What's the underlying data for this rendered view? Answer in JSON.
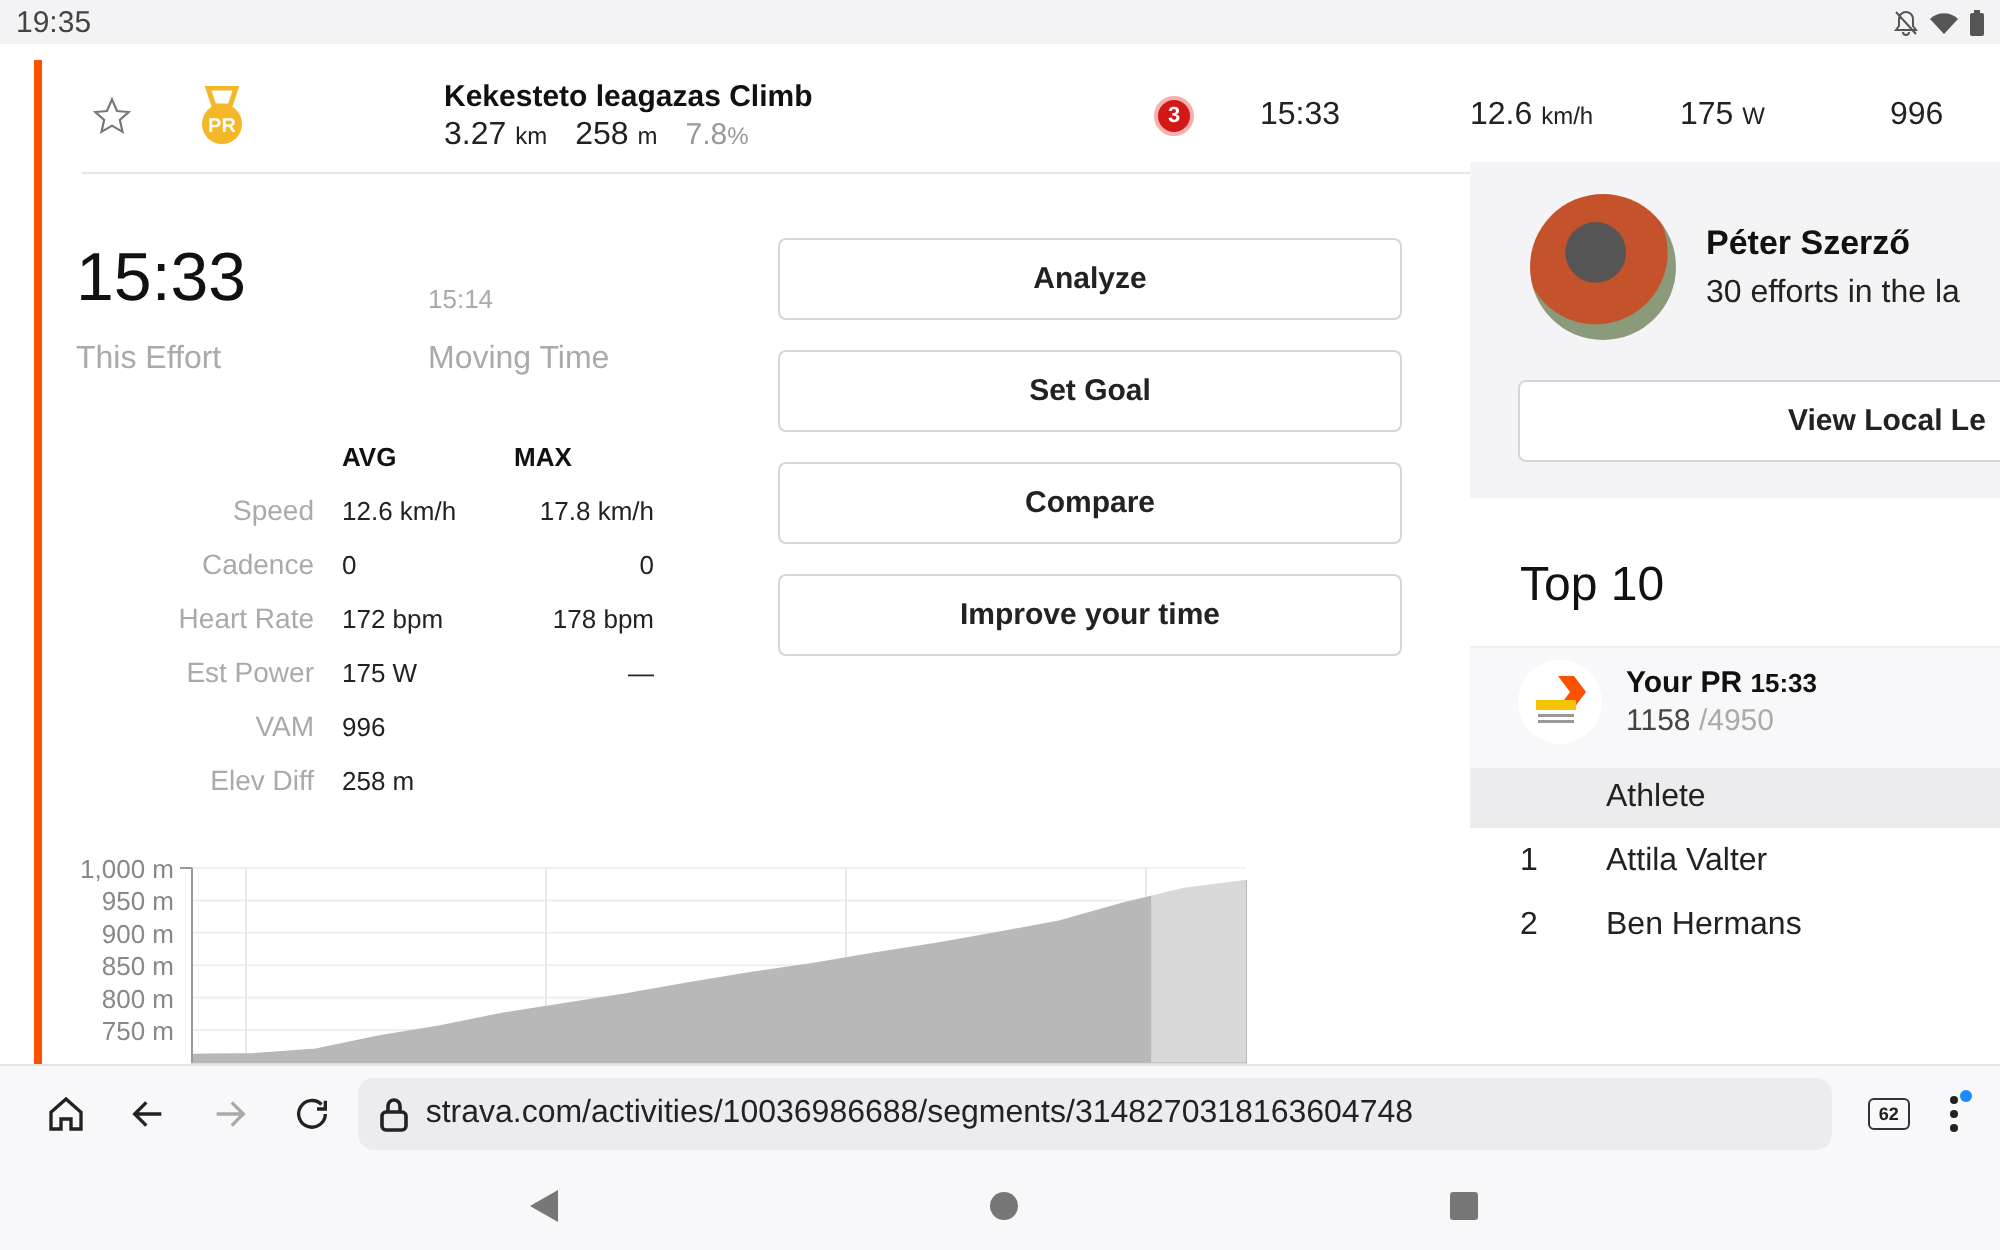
{
  "status_bar": {
    "time": "19:35"
  },
  "segment": {
    "starred": false,
    "pr_badge": "PR",
    "name": "Kekesteto leagazas Climb",
    "distance": {
      "value": "3.27",
      "unit": "km"
    },
    "elevation": {
      "value": "258",
      "unit": "m"
    },
    "grade": {
      "value": "7.8",
      "unit": "%"
    },
    "rank": "3",
    "time": "15:33",
    "speed": {
      "value": "12.6",
      "unit": "km/h"
    },
    "power": {
      "value": "175",
      "unit": "W"
    },
    "vam": "996"
  },
  "effort": {
    "time": "15:33",
    "time_label": "This Effort",
    "moving_time": "15:14",
    "moving_label": "Moving Time"
  },
  "stats": {
    "columns": [
      "AVG",
      "MAX"
    ],
    "rows": [
      {
        "label": "Speed",
        "avg": "12.6 km/h",
        "max": "17.8 km/h"
      },
      {
        "label": "Cadence",
        "avg": "0",
        "max": "0"
      },
      {
        "label": "Heart Rate",
        "avg": "172 bpm",
        "max": "178 bpm"
      },
      {
        "label": "Est Power",
        "avg": "175 W",
        "max": "—"
      },
      {
        "label": "VAM",
        "avg": "996"
      },
      {
        "label": "Elev Diff",
        "avg": "258 m"
      }
    ]
  },
  "actions": [
    "Analyze",
    "Set Goal",
    "Compare",
    "Improve your time"
  ],
  "elevation_chart": {
    "chart_data": {
      "type": "area",
      "grid": true,
      "categories": [
        null,
        null,
        null,
        null,
        null,
        null,
        null,
        null,
        null,
        null,
        null,
        null,
        null,
        null,
        null,
        null,
        null,
        null
      ],
      "ylim": [
        700,
        1000
      ],
      "yticks": [
        {
          "value": 750,
          "label": "750 m"
        },
        {
          "value": 800,
          "label": "800 m"
        },
        {
          "value": 850,
          "label": "850 m"
        },
        {
          "value": 900,
          "label": "900 m"
        },
        {
          "value": 950,
          "label": "950 m"
        },
        {
          "value": 1000,
          "label": "1,000 m"
        }
      ],
      "series": [
        {
          "color": "#b8b8b8",
          "values": [
            712,
            713,
            720,
            740,
            756,
            775,
            790,
            805,
            822,
            838,
            852,
            868,
            883,
            900,
            918,
            945,
            968,
            980
          ]
        }
      ]
    }
  },
  "local_legend": {
    "name": "Péter Szerző",
    "subtitle": "30 efforts in the la",
    "button": "View Local Le"
  },
  "leaderboard": {
    "title": "Top 10",
    "your_pr": {
      "label": "Your PR",
      "time": "15:33",
      "rank": "1158",
      "total": "/4950"
    },
    "header": "Athlete",
    "rows": [
      {
        "rank": "1",
        "athlete": "Attila Valter"
      },
      {
        "rank": "2",
        "athlete": "Ben Hermans"
      }
    ]
  },
  "browser": {
    "url": "strava.com/activities/10036986688/segments/3148270318163604748",
    "tab_count": "62",
    "forward_disabled": true,
    "menu_notification": true
  }
}
